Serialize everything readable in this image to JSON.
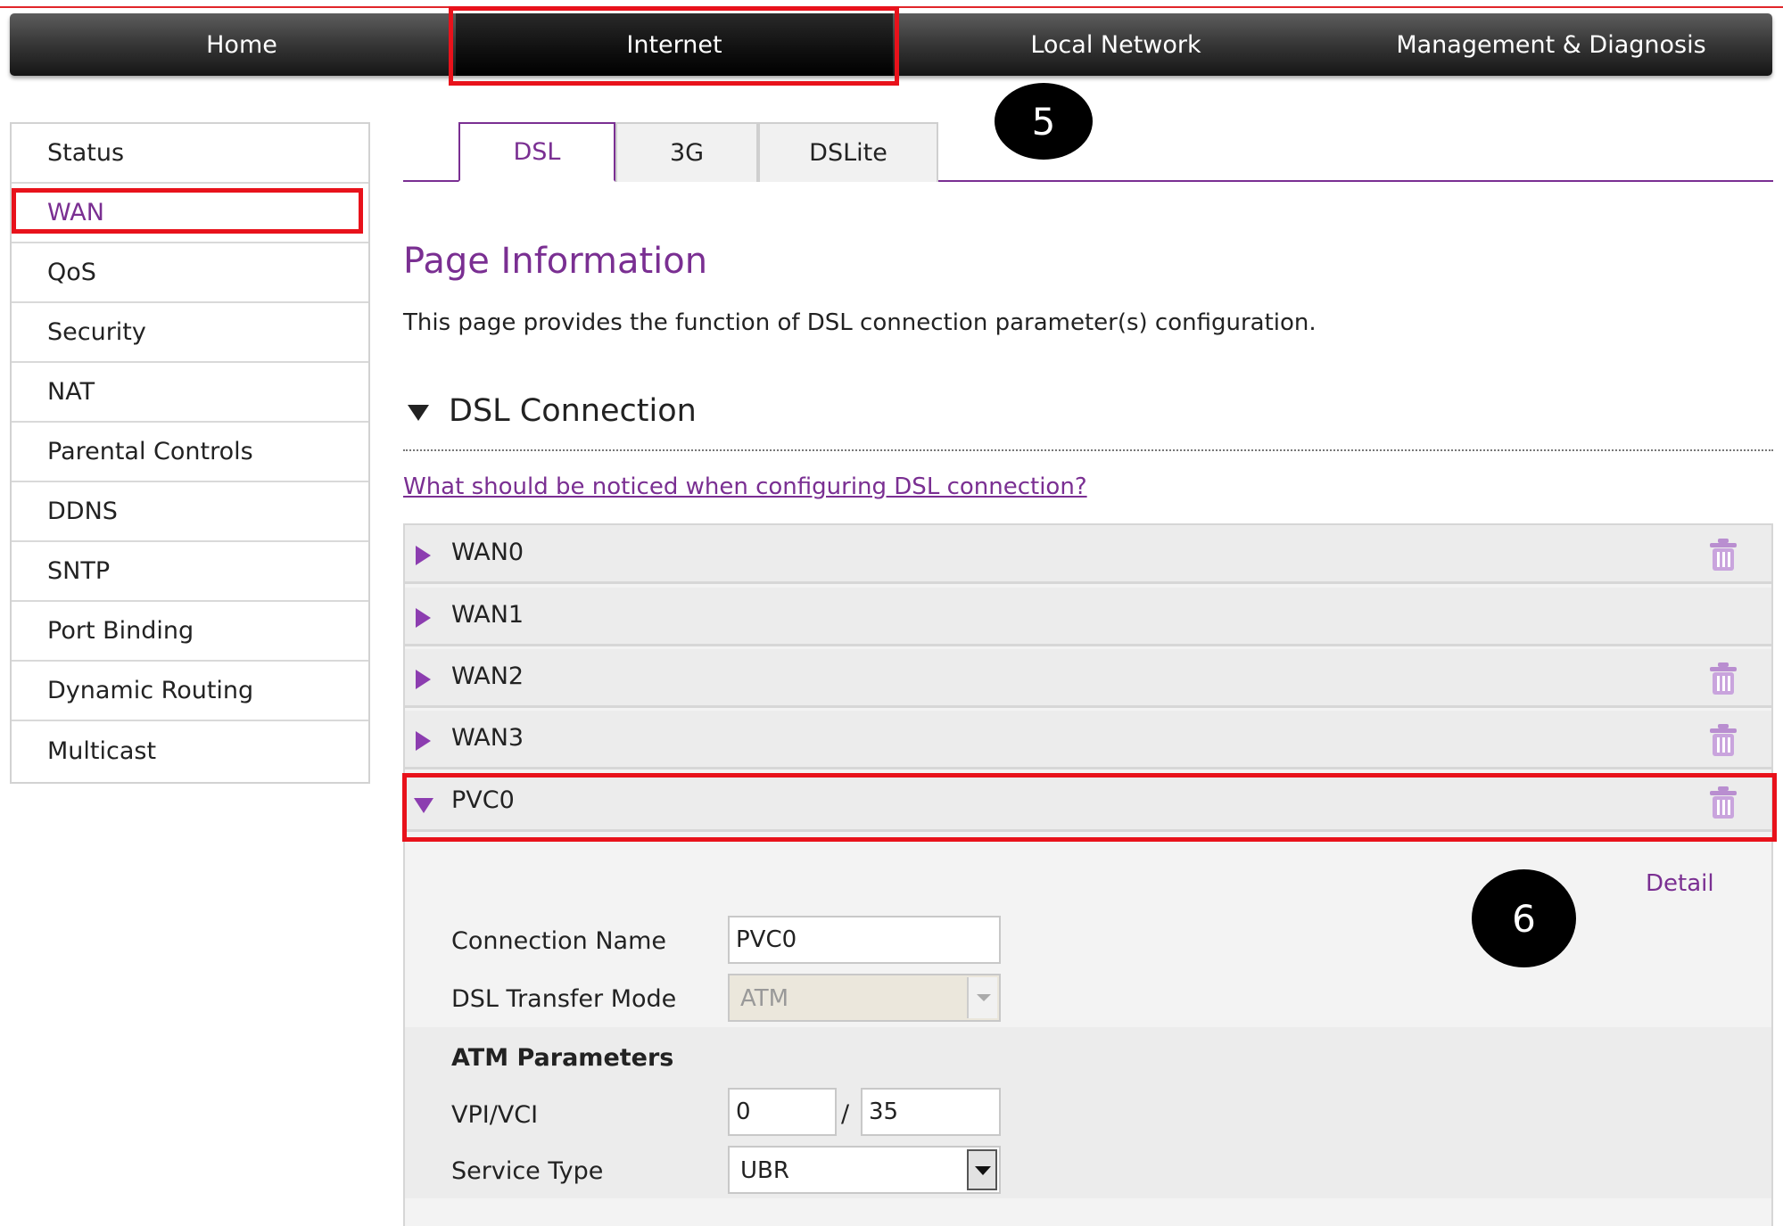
{
  "topnav": {
    "items": [
      {
        "label": "Home"
      },
      {
        "label": "Internet"
      },
      {
        "label": "Local Network"
      },
      {
        "label": "Management & Diagnosis"
      }
    ]
  },
  "sidebar": {
    "items": [
      {
        "label": "Status"
      },
      {
        "label": "WAN"
      },
      {
        "label": "QoS"
      },
      {
        "label": "Security"
      },
      {
        "label": "NAT"
      },
      {
        "label": "Parental Controls"
      },
      {
        "label": "DDNS"
      },
      {
        "label": "SNTP"
      },
      {
        "label": "Port Binding"
      },
      {
        "label": "Dynamic Routing"
      },
      {
        "label": "Multicast"
      }
    ],
    "active_item": "WAN"
  },
  "tabs": [
    {
      "label": "DSL"
    },
    {
      "label": "3G"
    },
    {
      "label": "DSLite"
    }
  ],
  "page": {
    "title": "Page Information",
    "description": "This page provides the function of DSL connection parameter(s) configuration."
  },
  "section": {
    "title": "DSL Connection",
    "help_link": "What should be noticed when configuring DSL connection?"
  },
  "connections": [
    {
      "label": "WAN0",
      "deletable": true
    },
    {
      "label": "WAN1",
      "deletable": false
    },
    {
      "label": "WAN2",
      "deletable": true
    },
    {
      "label": "WAN3",
      "deletable": true
    },
    {
      "label": "PVC0",
      "deletable": true,
      "expanded": true
    }
  ],
  "form": {
    "detail_link": "Detail",
    "connection_name_label": "Connection Name",
    "connection_name_value": "PVC0",
    "transfer_mode_label": "DSL Transfer Mode",
    "transfer_mode_value": "ATM",
    "atm_heading": "ATM Parameters",
    "vpi_vci_label": "VPI/VCI",
    "vpi_value": "0",
    "vci_separator": "/",
    "vci_value": "35",
    "service_type_label": "Service Type",
    "service_type_value": "UBR"
  },
  "annotations": {
    "step_a": "5",
    "step_b": "6"
  },
  "colors": {
    "accent": "#7a2f92",
    "highlight": "#e8121b",
    "row_arrow": "#8c3db0",
    "nav_bg": "#2a2a2a"
  }
}
